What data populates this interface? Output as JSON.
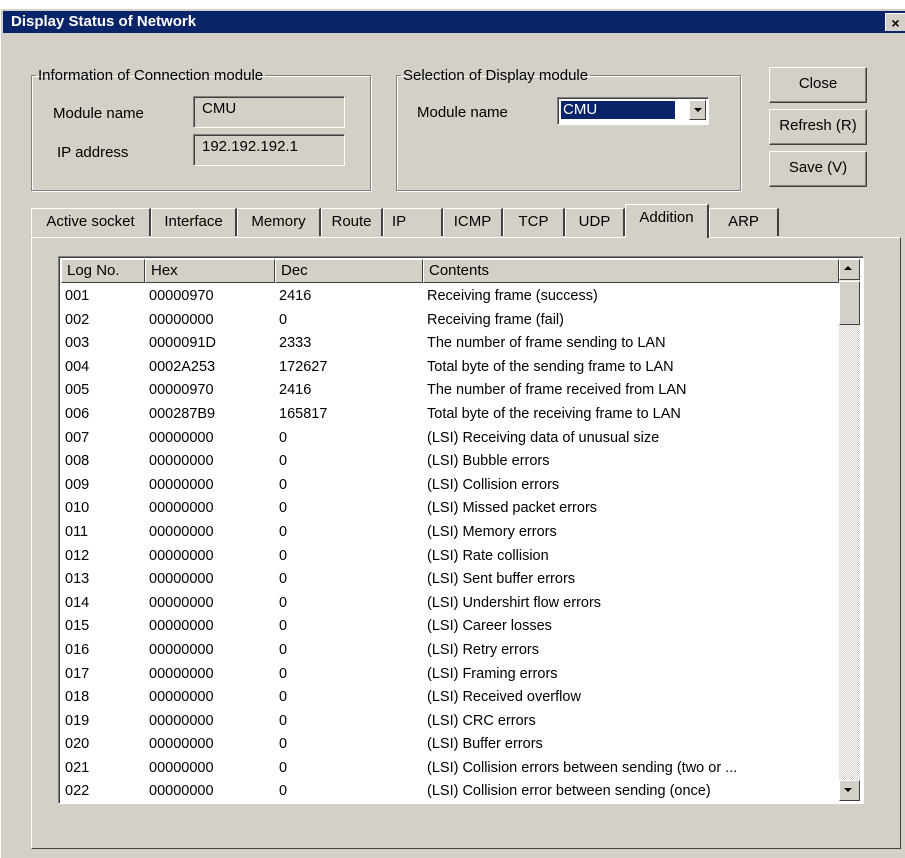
{
  "window": {
    "title": "Display Status of Network",
    "close_glyph": "×"
  },
  "connection": {
    "legend": "Information of Connection module",
    "module_name_label": "Module name",
    "module_name_value": "CMU",
    "ip_label": "IP address",
    "ip_value": "192.192.192.1"
  },
  "display": {
    "legend": "Selection of Display module",
    "module_name_label": "Module name",
    "selected": "CMU"
  },
  "buttons": {
    "close": "Close",
    "refresh": "Refresh (R)",
    "save": "Save (V)"
  },
  "tabs": [
    {
      "label": "Active socket"
    },
    {
      "label": "Interface"
    },
    {
      "label": "Memory"
    },
    {
      "label": "Route"
    },
    {
      "label": "IP"
    },
    {
      "label": "ICMP"
    },
    {
      "label": "TCP"
    },
    {
      "label": "UDP"
    },
    {
      "label": "Addition",
      "active": true
    },
    {
      "label": "ARP"
    }
  ],
  "table": {
    "columns": [
      "Log No.",
      "Hex",
      "Dec",
      "Contents"
    ],
    "rows": [
      [
        "001",
        "00000970",
        "2416",
        "Receiving frame (success)"
      ],
      [
        "002",
        "00000000",
        "0",
        "Receiving frame (fail)"
      ],
      [
        "003",
        "0000091D",
        "2333",
        "The number of frame sending to LAN"
      ],
      [
        "004",
        "0002A253",
        "172627",
        "Total byte of the sending frame to LAN"
      ],
      [
        "005",
        "00000970",
        "2416",
        "The number of frame received from LAN"
      ],
      [
        "006",
        "000287B9",
        "165817",
        "Total byte of the receiving frame to LAN"
      ],
      [
        "007",
        "00000000",
        "0",
        "(LSI) Receiving data of unusual size"
      ],
      [
        "008",
        "00000000",
        "0",
        "(LSI) Bubble errors"
      ],
      [
        "009",
        "00000000",
        "0",
        "(LSI) Collision errors"
      ],
      [
        "010",
        "00000000",
        "0",
        "(LSI) Missed packet errors"
      ],
      [
        "011",
        "00000000",
        "0",
        "(LSI) Memory errors"
      ],
      [
        "012",
        "00000000",
        "0",
        "(LSI) Rate collision"
      ],
      [
        "013",
        "00000000",
        "0",
        "(LSI) Sent buffer errors"
      ],
      [
        "014",
        "00000000",
        "0",
        "(LSI) Undershirt flow errors"
      ],
      [
        "015",
        "00000000",
        "0",
        "(LSI) Career losses"
      ],
      [
        "016",
        "00000000",
        "0",
        "(LSI) Retry errors"
      ],
      [
        "017",
        "00000000",
        "0",
        "(LSI) Framing errors"
      ],
      [
        "018",
        "00000000",
        "0",
        "(LSI) Received overflow"
      ],
      [
        "019",
        "00000000",
        "0",
        "(LSI) CRC errors"
      ],
      [
        "020",
        "00000000",
        "0",
        "(LSI) Buffer errors"
      ],
      [
        "021",
        "00000000",
        "0",
        "(LSI) Collision errors between sending (two or ..."
      ],
      [
        "022",
        "00000000",
        "0",
        "(LSI) Collision error between sending (once)"
      ]
    ]
  }
}
